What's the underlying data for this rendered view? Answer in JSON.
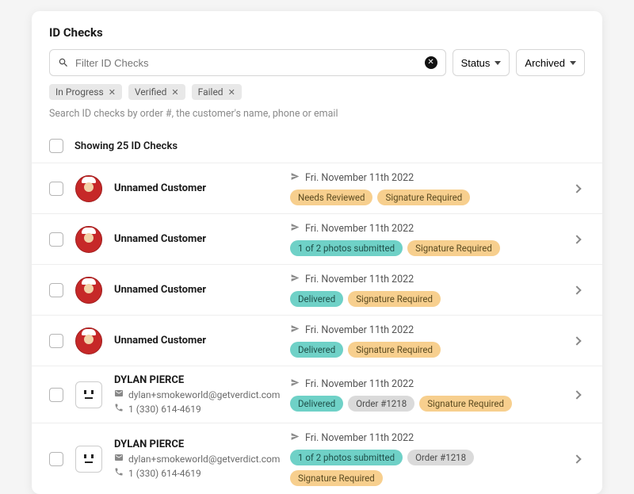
{
  "title": "ID Checks",
  "search": {
    "placeholder": "Filter ID Checks"
  },
  "dropdowns": {
    "status": "Status",
    "archived": "Archived"
  },
  "filters": [
    {
      "label": "In Progress"
    },
    {
      "label": "Verified"
    },
    {
      "label": "Failed"
    }
  ],
  "hint": "Search ID checks by order #, the customer's name, phone or email",
  "count_text": "Showing 25 ID Checks",
  "rows": [
    {
      "avatar": "photo",
      "customer_name": "Unnamed Customer",
      "email": "",
      "phone": "",
      "date": "Fri. November 11th 2022",
      "tags": [
        {
          "text": "Needs Reviewed",
          "cls": "tag-orange"
        },
        {
          "text": "Signature Required",
          "cls": "tag-orange"
        }
      ]
    },
    {
      "avatar": "photo",
      "customer_name": "Unnamed Customer",
      "email": "",
      "phone": "",
      "date": "Fri. November 11th 2022",
      "tags": [
        {
          "text": "1 of 2 photos submitted",
          "cls": "tag-teal"
        },
        {
          "text": "Signature Required",
          "cls": "tag-orange"
        }
      ]
    },
    {
      "avatar": "photo",
      "customer_name": "Unnamed Customer",
      "email": "",
      "phone": "",
      "date": "Fri. November 11th 2022",
      "tags": [
        {
          "text": "Delivered",
          "cls": "tag-teal"
        },
        {
          "text": "Signature Required",
          "cls": "tag-orange"
        }
      ]
    },
    {
      "avatar": "photo",
      "customer_name": "Unnamed Customer",
      "email": "",
      "phone": "",
      "date": "Fri. November 11th 2022",
      "tags": [
        {
          "text": "Delivered",
          "cls": "tag-teal"
        },
        {
          "text": "Signature Required",
          "cls": "tag-orange"
        }
      ]
    },
    {
      "avatar": "face",
      "customer_name": "DYLAN PIERCE",
      "email": "dylan+smokeworld@getverdict.com",
      "phone": "1 (330) 614-4619",
      "date": "Fri. November 11th 2022",
      "tags": [
        {
          "text": "Delivered",
          "cls": "tag-teal"
        },
        {
          "text": "Order #1218",
          "cls": "tag-grey"
        },
        {
          "text": "Signature Required",
          "cls": "tag-orange"
        }
      ]
    },
    {
      "avatar": "face",
      "customer_name": "DYLAN PIERCE",
      "email": "dylan+smokeworld@getverdict.com",
      "phone": "1 (330) 614-4619",
      "date": "Fri. November 11th 2022",
      "tags": [
        {
          "text": "1 of 2 photos submitted",
          "cls": "tag-teal"
        },
        {
          "text": "Order #1218",
          "cls": "tag-grey"
        },
        {
          "text": "Signature Required",
          "cls": "tag-orange"
        }
      ]
    }
  ]
}
